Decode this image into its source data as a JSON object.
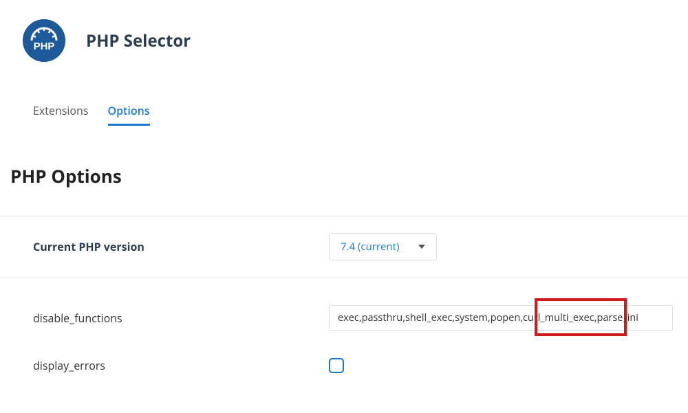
{
  "header": {
    "title": "PHP Selector",
    "icon_text": "PHP"
  },
  "tabs": {
    "extensions_label": "Extensions",
    "options_label": "Options"
  },
  "section": {
    "title": "PHP Options"
  },
  "version_row": {
    "label": "Current PHP version",
    "selected": "7.4 (current)"
  },
  "options": {
    "disable_functions": {
      "label": "disable_functions",
      "value": "exec,passthru,shell_exec,system,popen,curl_multi_exec,parse_ini"
    },
    "display_errors": {
      "label": "display_errors"
    }
  }
}
